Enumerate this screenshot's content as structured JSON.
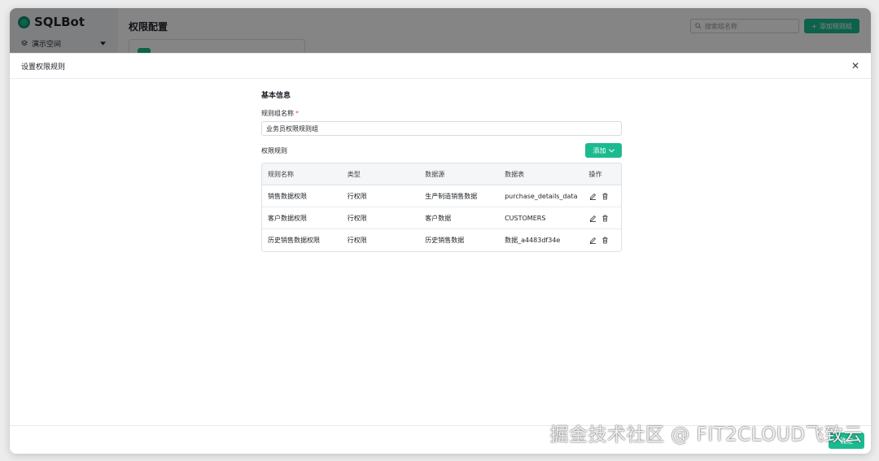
{
  "app": {
    "logo_text": "SQLBot",
    "workspace": "演示空间",
    "page_title": "权限配置",
    "search_placeholder": "搜索组名称",
    "add_group_label": "添加规则组"
  },
  "drawer": {
    "title": "设置权限规则",
    "section_title": "基本信息",
    "group_name_label": "规则组名称",
    "required_mark": "*",
    "group_name_value": "业务员权限规则组",
    "rules_label": "权限规则",
    "add_label": "添加",
    "table": {
      "headers": [
        "规则名称",
        "类型",
        "数据源",
        "数据表",
        "操作"
      ],
      "rows": [
        [
          "销售数据权限",
          "行权限",
          "生产制造销售数据",
          "purchase_details_data"
        ],
        [
          "客户数据权限",
          "行权限",
          "客户数据",
          "CUSTOMERS"
        ],
        [
          "历史销售数据权限",
          "行权限",
          "历史销售数据",
          "数据_a4483df34e"
        ]
      ]
    },
    "footer_confirm": "确定"
  },
  "watermark": "掘金技术社区 @ FIT2CLOUD飞致云",
  "colors": {
    "accent": "#1cba90",
    "required": "#f54a45"
  },
  "icons": [
    "search-icon",
    "layers-icon",
    "caret-down-icon",
    "plus-icon",
    "close-icon",
    "chevron-down-icon",
    "edit-icon",
    "trash-icon"
  ]
}
